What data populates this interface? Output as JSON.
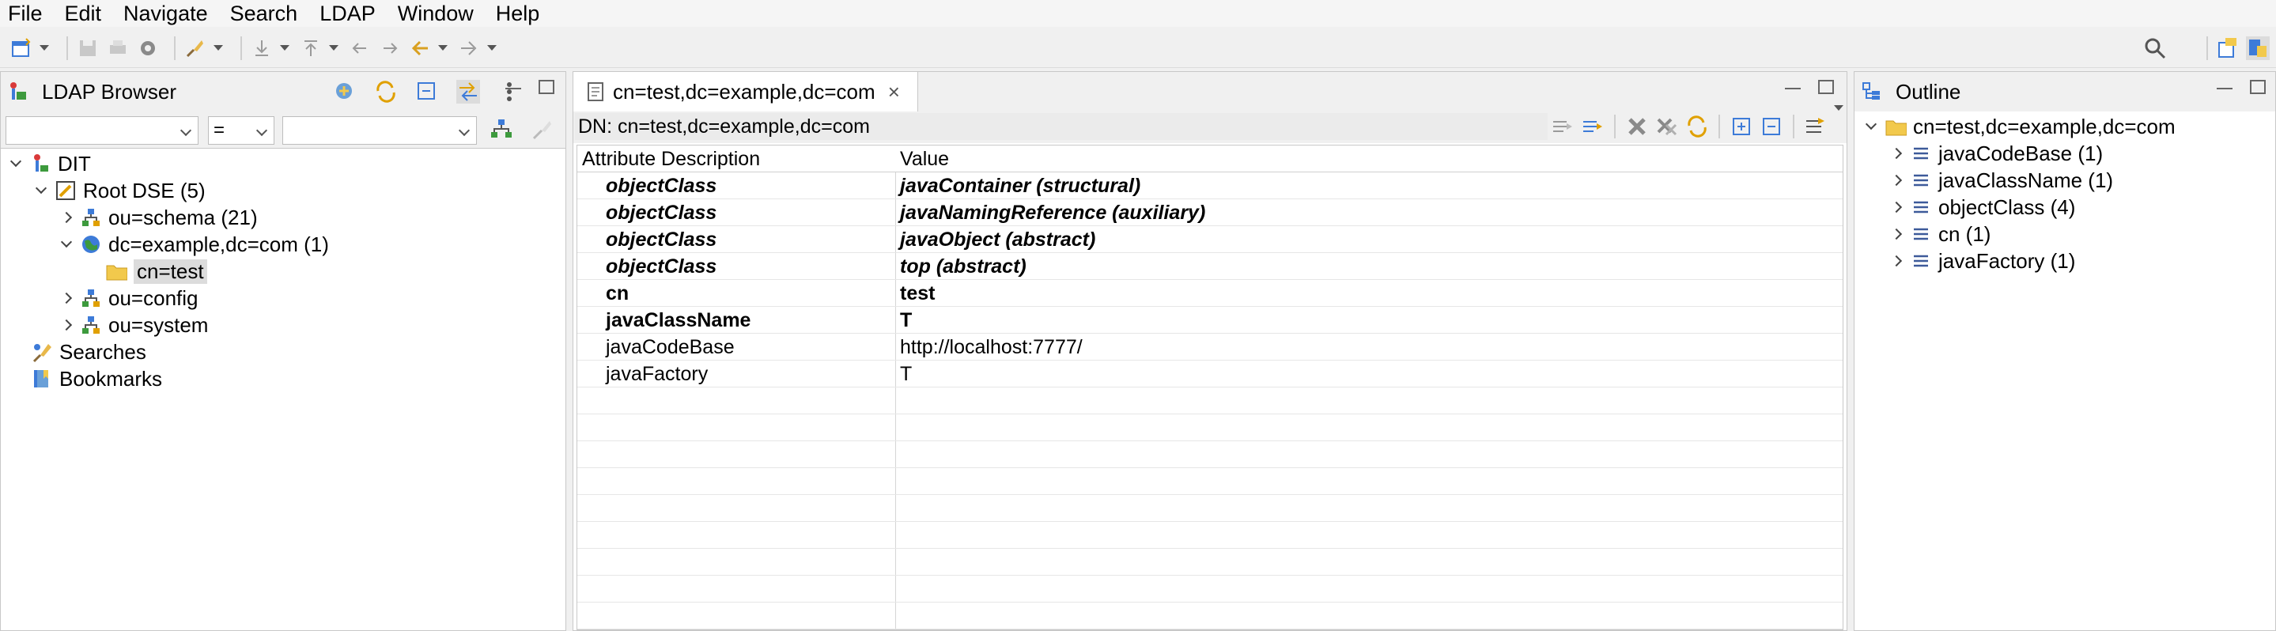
{
  "menu": [
    "File",
    "Edit",
    "Navigate",
    "Search",
    "LDAP",
    "Window",
    "Help"
  ],
  "colors": {
    "folder": "#f2c94c",
    "accent": "#3d7bd8",
    "bg": "#f0f0f0"
  },
  "ldap_browser": {
    "title": "LDAP Browser",
    "filter": {
      "attribute": "",
      "operator": "=",
      "value": ""
    },
    "tree": [
      {
        "label": "DIT",
        "icon": "dit-icon",
        "expanded": true
      },
      {
        "label": "Root DSE (5)",
        "icon": "root-dse-icon",
        "expanded": true
      },
      {
        "label": "ou=schema (21)",
        "icon": "org-unit-icon",
        "expanded": false
      },
      {
        "label": "dc=example,dc=com (1)",
        "icon": "globe-icon",
        "expanded": true
      },
      {
        "label": "cn=test",
        "icon": "folder-icon",
        "selected": true
      },
      {
        "label": "ou=config",
        "icon": "org-unit-icon",
        "expanded": false
      },
      {
        "label": "ou=system",
        "icon": "org-unit-icon",
        "expanded": false
      },
      {
        "label": "Searches",
        "icon": "searches-icon"
      },
      {
        "label": "Bookmarks",
        "icon": "bookmarks-icon"
      }
    ]
  },
  "editor": {
    "tab_label": "cn=test,dc=example,dc=com",
    "dn": "DN: cn=test,dc=example,dc=com",
    "columns": [
      "Attribute Description",
      "Value"
    ],
    "rows": [
      {
        "attr": "objectClass",
        "value": "javaContainer (structural)",
        "style": "bi"
      },
      {
        "attr": "objectClass",
        "value": "javaNamingReference (auxiliary)",
        "style": "bi"
      },
      {
        "attr": "objectClass",
        "value": "javaObject (abstract)",
        "style": "bi"
      },
      {
        "attr": "objectClass",
        "value": "top (abstract)",
        "style": "bi"
      },
      {
        "attr": "cn",
        "value": "test",
        "style": "b"
      },
      {
        "attr": "javaClassName",
        "value": "T",
        "style": "b"
      },
      {
        "attr": "javaCodeBase",
        "value": "http://localhost:7777/",
        "style": ""
      },
      {
        "attr": "javaFactory",
        "value": "T",
        "style": ""
      }
    ]
  },
  "outline": {
    "title": "Outline",
    "root": "cn=test,dc=example,dc=com",
    "items": [
      "javaCodeBase (1)",
      "javaClassName (1)",
      "objectClass (4)",
      "cn (1)",
      "javaFactory (1)"
    ]
  }
}
